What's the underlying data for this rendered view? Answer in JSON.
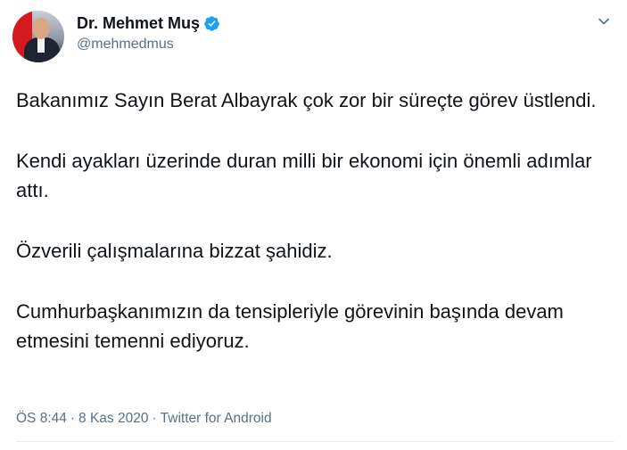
{
  "author": {
    "display_name": "Dr. Mehmet Muş",
    "handle": "@mehmedmus",
    "verified": true
  },
  "tweet": {
    "paragraphs": [
      "Bakanımız Sayın Berat Albayrak çok zor bir süreçte görev üstlendi.",
      "Kendi ayakları üzerinde duran milli bir ekonomi için önemli adımlar attı.",
      "Özverili çalışmalarına bizzat şahidiz.",
      "Cumhurbaşkanımızın da tensipleriyle görevinin başında devam etmesini temenni ediyoruz."
    ]
  },
  "meta": {
    "time": "ÖS 8:44",
    "date": "8 Kas 2020",
    "source": "Twitter for Android",
    "separator": "·"
  },
  "icons": {
    "verified": "verified-badge-icon",
    "more": "chevron-down-icon"
  },
  "colors": {
    "verified_blue": "#1da1f2",
    "secondary_text": "#5b7083"
  }
}
